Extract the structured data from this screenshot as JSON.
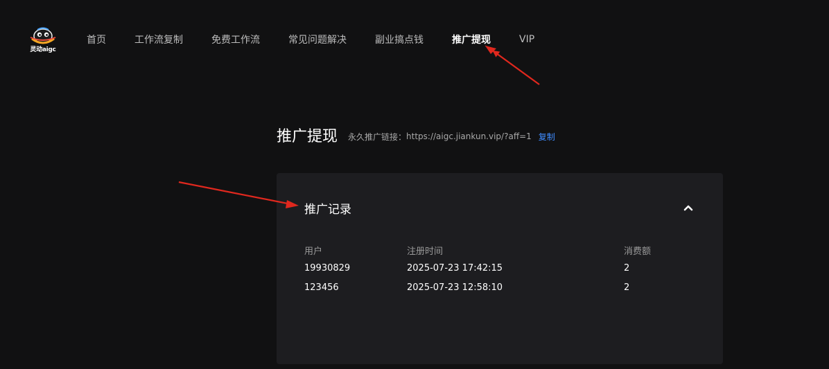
{
  "header": {
    "logo_text": "灵动aigc",
    "nav": [
      {
        "label": "首页"
      },
      {
        "label": "工作流复制"
      },
      {
        "label": "免费工作流"
      },
      {
        "label": "常见问题解决"
      },
      {
        "label": "副业搞点钱"
      },
      {
        "label": "推广提现"
      },
      {
        "label": "VIP"
      }
    ],
    "active_index": 5
  },
  "main": {
    "title": "推广提现",
    "aff_label": "永久推广链接：",
    "aff_link": "https://aigc.jiankun.vip/?aff=1",
    "copy_label": "复制"
  },
  "record_card": {
    "title": "推广记录",
    "expanded": true,
    "columns": [
      "用户",
      "注册时间",
      "消费额"
    ],
    "rows": [
      {
        "user": "19930829",
        "time": "2025-07-23 17:42:15",
        "amount": "2"
      },
      {
        "user": "123456",
        "time": "2025-07-23 12:58:10",
        "amount": "2"
      }
    ]
  },
  "colors": {
    "background": "#111112",
    "card": "#1d1d20",
    "link": "#3f8cff",
    "annotation_arrow": "#e0281e"
  }
}
